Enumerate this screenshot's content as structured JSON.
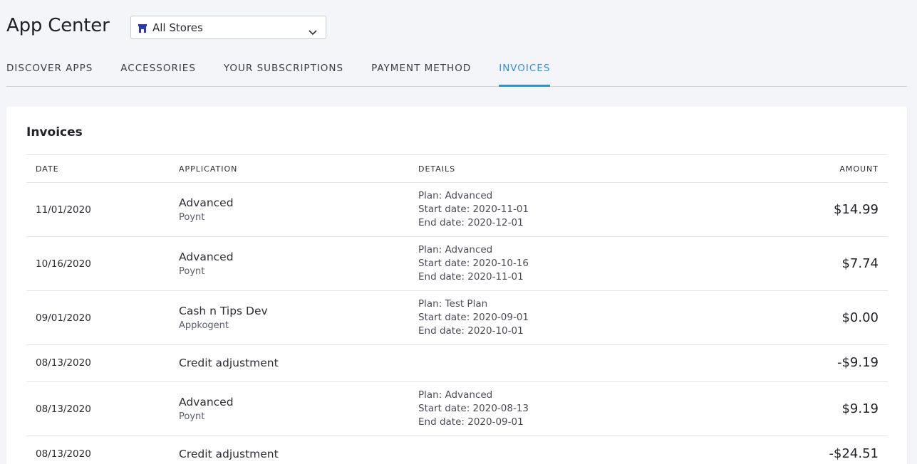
{
  "header": {
    "title": "App Center",
    "store_select": {
      "value": "All Stores"
    }
  },
  "tabs": [
    {
      "label": "DISCOVER APPS",
      "active": false
    },
    {
      "label": "ACCESSORIES",
      "active": false
    },
    {
      "label": "YOUR SUBSCRIPTIONS",
      "active": false
    },
    {
      "label": "PAYMENT METHOD",
      "active": false
    },
    {
      "label": "INVOICES",
      "active": true
    }
  ],
  "colors": {
    "accent": "#2f8fe0",
    "background": "#f4f5f9"
  },
  "invoices": {
    "title": "Invoices",
    "columns": {
      "date": "DATE",
      "application": "APPLICATION",
      "details": "DETAILS",
      "amount": "AMOUNT"
    },
    "rows": [
      {
        "date": "11/01/2020",
        "app": "Advanced",
        "publisher": "Poynt",
        "plan": "Plan: Advanced",
        "start": "Start date: 2020-11-01",
        "end": "End date: 2020-12-01",
        "amount": "$14.99"
      },
      {
        "date": "10/16/2020",
        "app": "Advanced",
        "publisher": "Poynt",
        "plan": "Plan: Advanced",
        "start": "Start date: 2020-10-16",
        "end": "End date: 2020-11-01",
        "amount": "$7.74"
      },
      {
        "date": "09/01/2020",
        "app": "Cash n Tips Dev",
        "publisher": "Appkogent",
        "plan": "Plan: Test Plan",
        "start": "Start date: 2020-09-01",
        "end": "End date: 2020-10-01",
        "amount": "$0.00"
      },
      {
        "date": "08/13/2020",
        "app": "Credit adjustment",
        "amount": "-$9.19"
      },
      {
        "date": "08/13/2020",
        "app": "Advanced",
        "publisher": "Poynt",
        "plan": "Plan: Advanced",
        "start": "Start date: 2020-08-13",
        "end": "End date: 2020-09-01",
        "amount": "$9.19"
      },
      {
        "date": "08/13/2020",
        "app": "Credit adjustment",
        "amount": "-$24.51"
      }
    ]
  }
}
